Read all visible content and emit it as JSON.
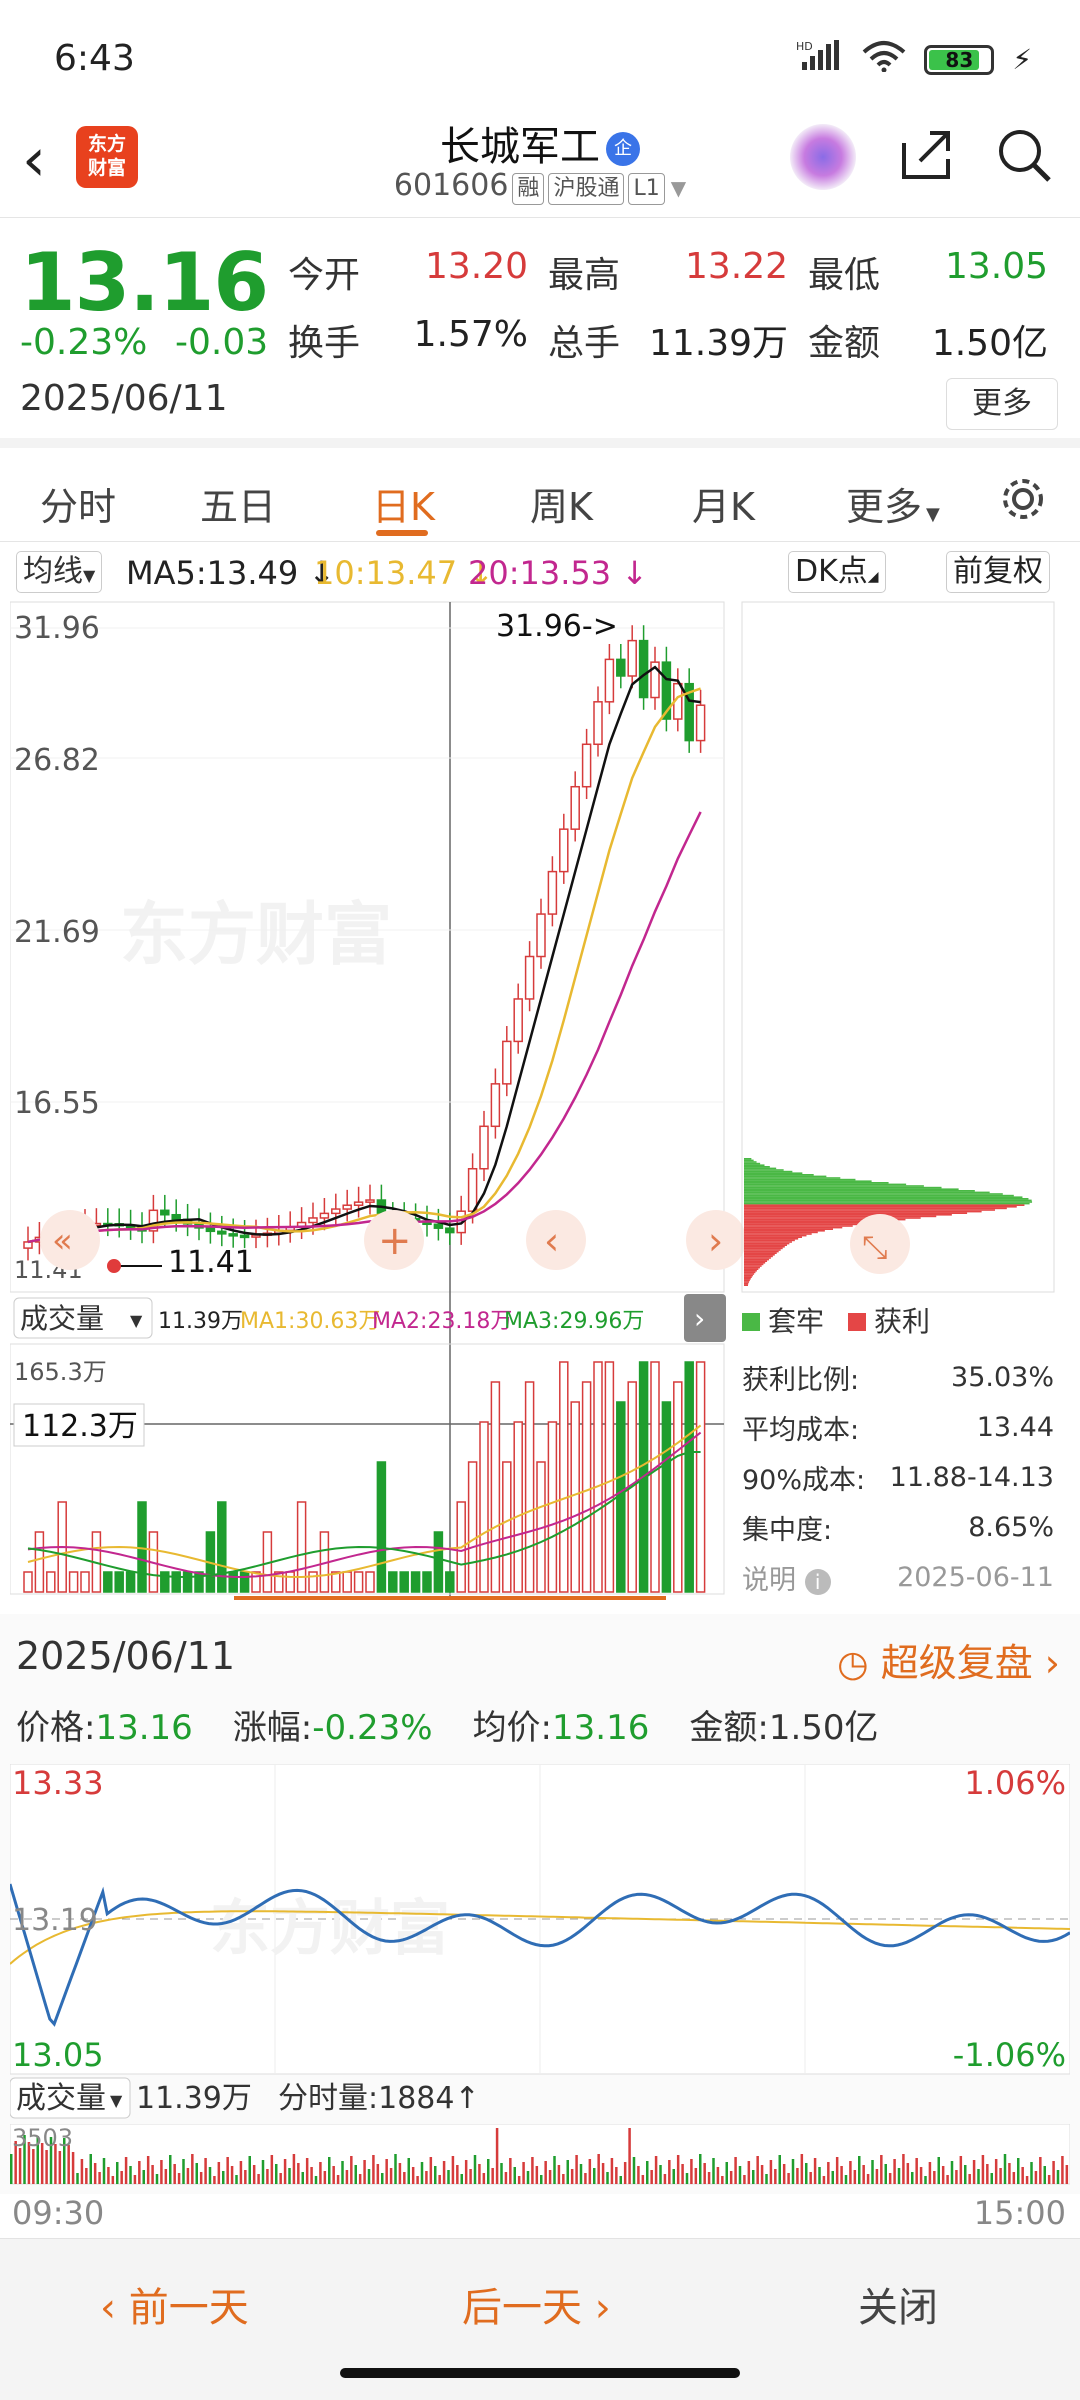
{
  "status_bar": {
    "time": "6:43",
    "battery": "83"
  },
  "header": {
    "back_icon": "chevron-left-icon",
    "app_logo": "东方\n财富",
    "stock_name": "长城军工",
    "qi_badge": "企",
    "code": "601606",
    "tags": [
      "融",
      "沪股通",
      "L1"
    ]
  },
  "quote": {
    "price": "13.16",
    "change_pct": "-0.23%",
    "change_abs": "-0.03",
    "date": "2025/06/11",
    "more": "更多",
    "rows": [
      [
        {
          "label": "今开",
          "value": "13.20",
          "color": "red"
        },
        {
          "label": "最高",
          "value": "13.22",
          "color": "red"
        },
        {
          "label": "最低",
          "value": "13.05",
          "color": "green"
        }
      ],
      [
        {
          "label": "换手",
          "value": "1.57%",
          "color": "black"
        },
        {
          "label": "总手",
          "value": "11.39万",
          "color": "black"
        },
        {
          "label": "金额",
          "value": "1.50亿",
          "color": "black"
        }
      ]
    ]
  },
  "tabs": [
    "分时",
    "五日",
    "日K",
    "周K",
    "月K",
    "更多"
  ],
  "active_tab": "日K",
  "ma_bar": {
    "selector": "均线",
    "ma5": "MA5:13.49",
    "ma10": "10:13.47",
    "ma20": "20:13.53",
    "dk": "DK点",
    "fuquan": "前复权"
  },
  "kline": {
    "y_labels": [
      "31.96",
      "26.82",
      "21.69",
      "16.55"
    ],
    "low_label": "11.41",
    "high_marker": "31.96->",
    "low_marker": "11.41",
    "watermark": "东方财富",
    "volume_label": "成交量",
    "volume_total": "11.39万",
    "vma1": "MA1:30.63万",
    "vma2": "MA2:23.18万",
    "vma3": "MA3:29.96万",
    "vol_max": "165.3万",
    "vol_cursor": "112.3万"
  },
  "chip": {
    "legend_trap": "套牢",
    "legend_profit": "获利",
    "rows": [
      {
        "label": "获利比例:",
        "value": "35.03%"
      },
      {
        "label": "平均成本:",
        "value": "13.44"
      },
      {
        "label": "90%成本:",
        "value": "11.88-14.13"
      },
      {
        "label": "集中度:",
        "value": "8.65%"
      }
    ],
    "note_label": "说明",
    "note_date": "2025-06-11"
  },
  "intraday": {
    "date": "2025/06/11",
    "fupan": "超级复盘",
    "price_label": "价格:",
    "price": "13.16",
    "chg_label": "涨幅:",
    "chg": "-0.23%",
    "avg_label": "均价:",
    "avg": "13.16",
    "amt_label": "金额:",
    "amt": "1.50亿",
    "top_price": "13.33",
    "mid_price": "13.19",
    "bot_price": "13.05",
    "top_pct": "1.06%",
    "bot_pct": "-1.06%",
    "vol_label": "成交量",
    "vol_total": "11.39万",
    "tick_vol": "分时量:1884↑",
    "vol_max": "3503",
    "t_start": "09:30",
    "t_end": "15:00"
  },
  "footer": {
    "prev": "前一天",
    "next": "后一天",
    "close": "关闭"
  },
  "colors": {
    "up": "#d63b3b",
    "down": "#1f9d2e",
    "accent": "#e06c1f",
    "ma5": "#111111",
    "ma10": "#e8b931",
    "ma20": "#c2278f"
  }
}
